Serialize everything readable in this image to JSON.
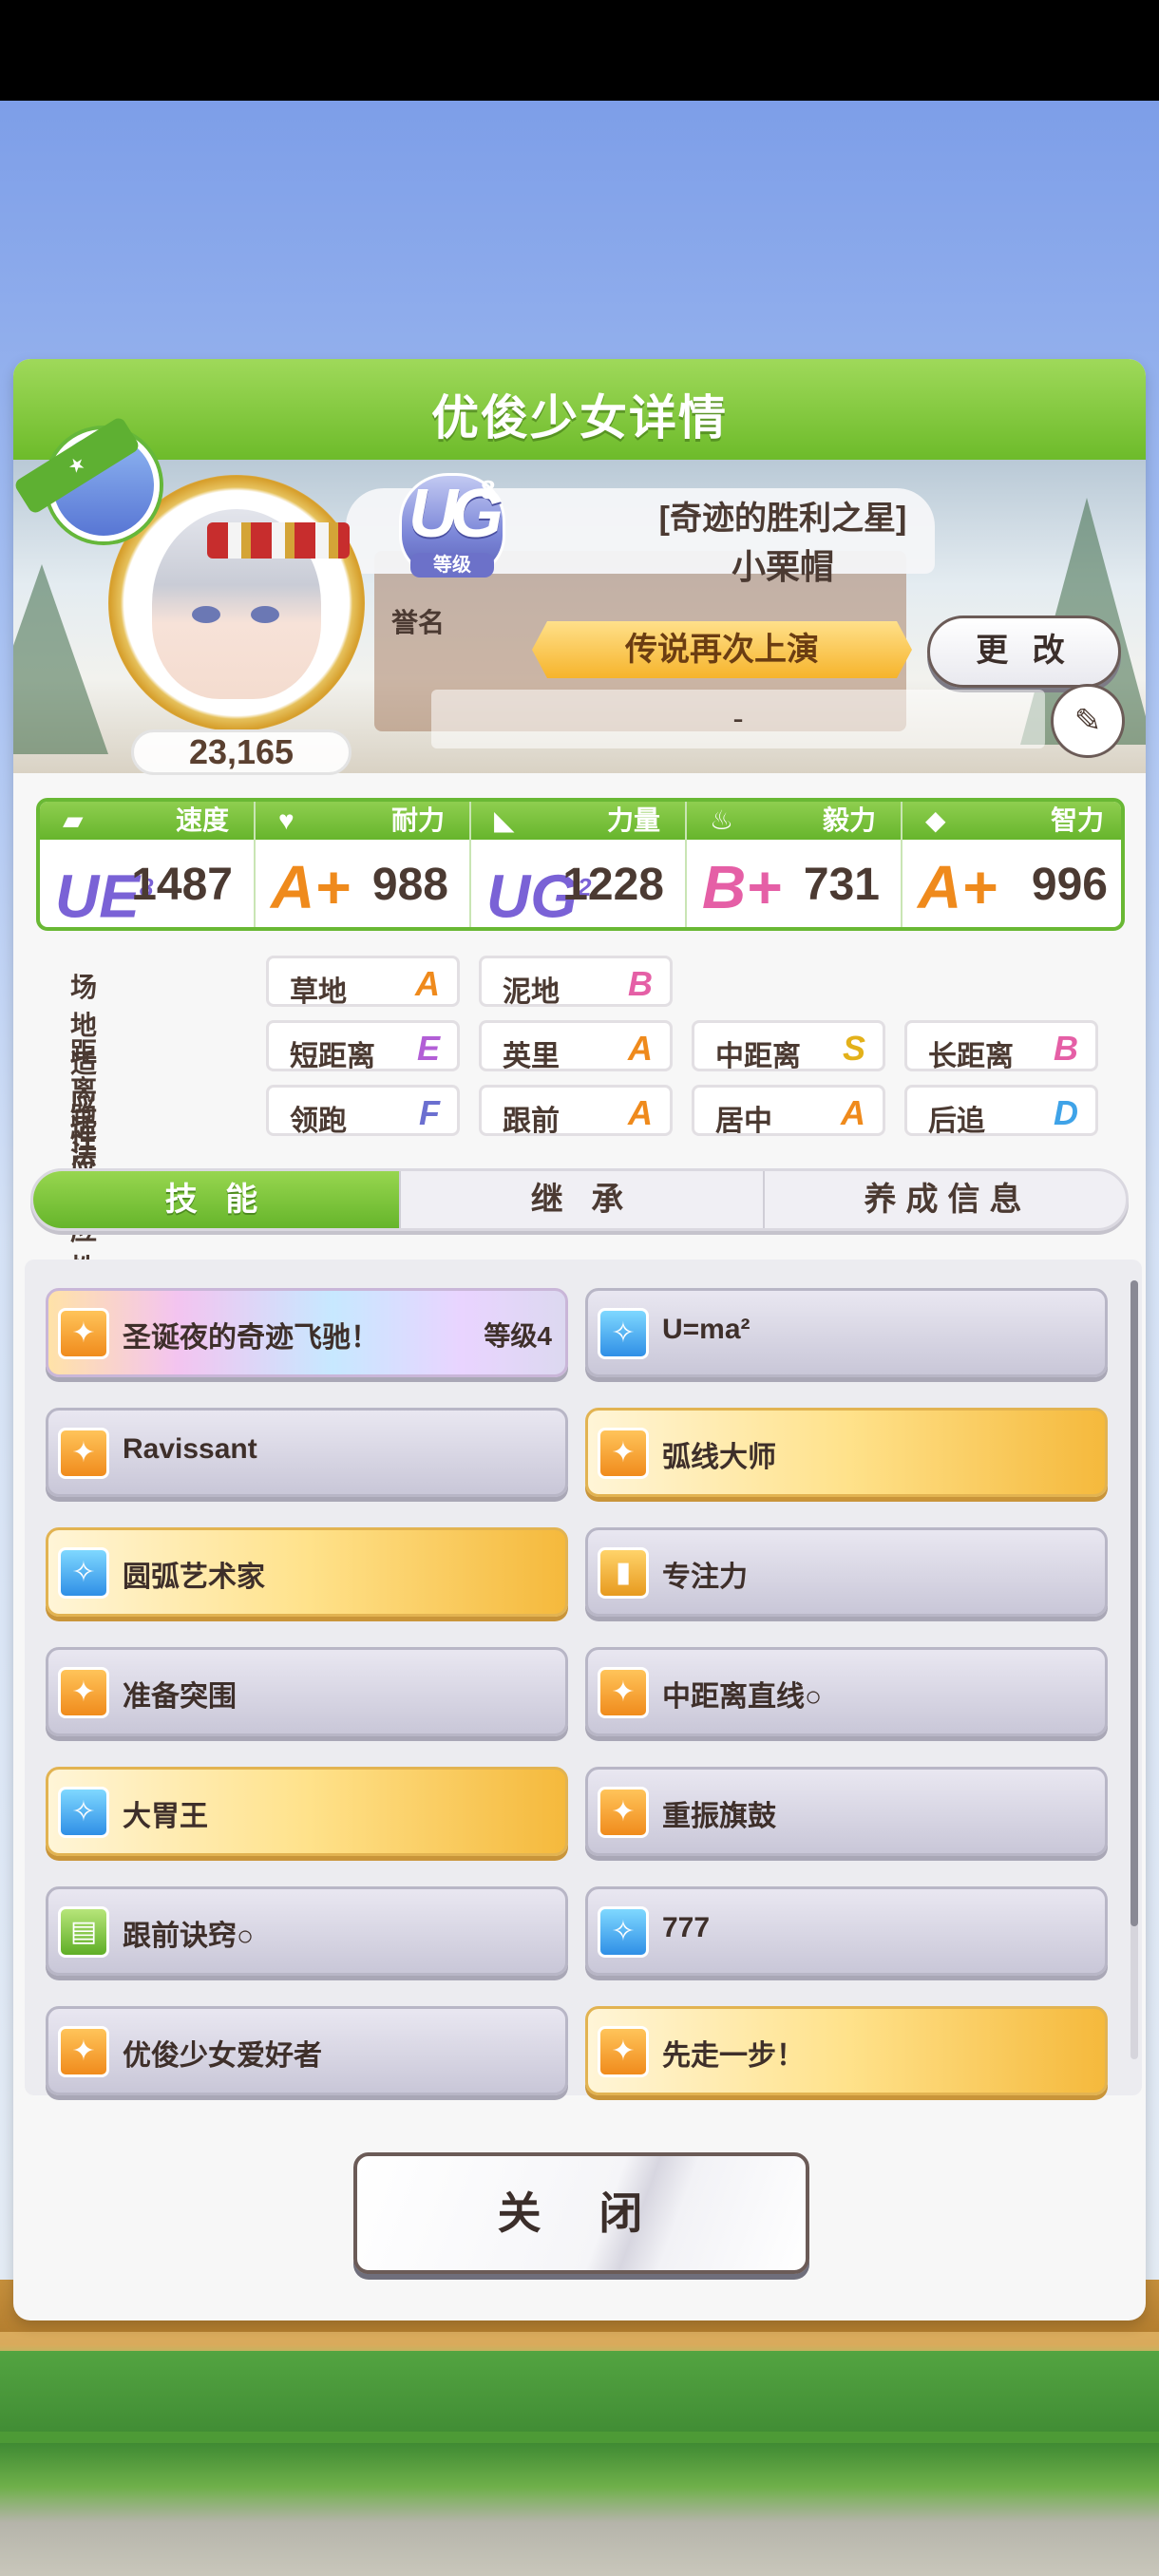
{
  "header": {
    "title": "优俊少女详情"
  },
  "profile": {
    "fans": "23,165",
    "rank": {
      "letters": "UG",
      "sup": "8",
      "tag": "等级",
      "label": "誉名"
    },
    "epithet": "[奇迹的胜利之星]",
    "name": "小栗帽",
    "title": "传说再次上演",
    "change_label": "更 改",
    "comment": "-"
  },
  "stats": [
    {
      "name": "速度",
      "icon": "shoe-icon",
      "glyph": "▰",
      "grade": "UE",
      "grade_sup": "8",
      "value": "1487",
      "color": "#7a62d6"
    },
    {
      "name": "耐力",
      "icon": "heart-icon",
      "glyph": "♥",
      "grade": "A+",
      "grade_sup": "",
      "value": "988",
      "color": "#ef8a1c"
    },
    {
      "name": "力量",
      "icon": "arm-icon",
      "glyph": "◣",
      "grade": "UG",
      "grade_sup": "2",
      "value": "1228",
      "color": "#7a62d6"
    },
    {
      "name": "毅力",
      "icon": "flame-icon",
      "glyph": "♨",
      "grade": "B+",
      "grade_sup": "",
      "value": "731",
      "color": "#e55fa6"
    },
    {
      "name": "智力",
      "icon": "cap-icon",
      "glyph": "◆",
      "grade": "A+",
      "grade_sup": "",
      "value": "996",
      "color": "#ef8a1c"
    }
  ],
  "aptitude": {
    "field": {
      "label": "场地适应性",
      "items": [
        {
          "t": "草地",
          "g": "A",
          "c": "#ef8a1c"
        },
        {
          "t": "泥地",
          "g": "B",
          "c": "#e55fa6"
        }
      ]
    },
    "distance": {
      "label": "距离适应性",
      "items": [
        {
          "t": "短距离",
          "g": "E",
          "c": "#b25ed6"
        },
        {
          "t": "英里",
          "g": "A",
          "c": "#ef8a1c"
        },
        {
          "t": "中距离",
          "g": "S",
          "c": "#e3b11a"
        },
        {
          "t": "长距离",
          "g": "B",
          "c": "#e55fa6"
        }
      ]
    },
    "style": {
      "label": "跑法适应性",
      "items": [
        {
          "t": "领跑",
          "g": "F",
          "c": "#6b6fd0"
        },
        {
          "t": "跟前",
          "g": "A",
          "c": "#ef8a1c"
        },
        {
          "t": "居中",
          "g": "A",
          "c": "#ef8a1c"
        },
        {
          "t": "后追",
          "g": "D",
          "c": "#3fa3e8"
        }
      ]
    }
  },
  "tabs": [
    {
      "label": "技 能"
    },
    {
      "label": "继 承"
    },
    {
      "label": "养成信息"
    }
  ],
  "skills": [
    {
      "name": "圣诞夜的奇迹飞驰！",
      "level": "等级4",
      "icon": "speed-icon",
      "style": "unique"
    },
    {
      "name": "U=ma²",
      "level": "",
      "icon": "recover-icon",
      "style": "normal"
    },
    {
      "name": "Ravissant",
      "level": "",
      "icon": "speed-icon",
      "style": "normal"
    },
    {
      "name": "弧线大师",
      "level": "",
      "icon": "speed-icon",
      "style": "gold"
    },
    {
      "name": "圆弧艺术家",
      "level": "",
      "icon": "recover-icon",
      "style": "gold"
    },
    {
      "name": "专注力",
      "level": "",
      "icon": "focus-icon",
      "style": "normal"
    },
    {
      "name": "准备突围",
      "level": "",
      "icon": "speed-icon",
      "style": "normal"
    },
    {
      "name": "中距离直线○",
      "level": "",
      "icon": "speed-icon",
      "style": "normal"
    },
    {
      "name": "大胃王",
      "level": "",
      "icon": "recover-icon",
      "style": "gold"
    },
    {
      "name": "重振旗鼓",
      "level": "",
      "icon": "speed-icon",
      "style": "normal"
    },
    {
      "name": "跟前诀窍○",
      "level": "",
      "icon": "book-icon",
      "style": "normal"
    },
    {
      "name": "777",
      "level": "",
      "icon": "recover-icon",
      "style": "normal"
    },
    {
      "name": "优俊少女爱好者",
      "level": "",
      "icon": "speed-icon",
      "style": "normal"
    },
    {
      "name": "先走一步！",
      "level": "",
      "icon": "speed-icon",
      "style": "gold"
    }
  ],
  "close_label": "关 闭"
}
